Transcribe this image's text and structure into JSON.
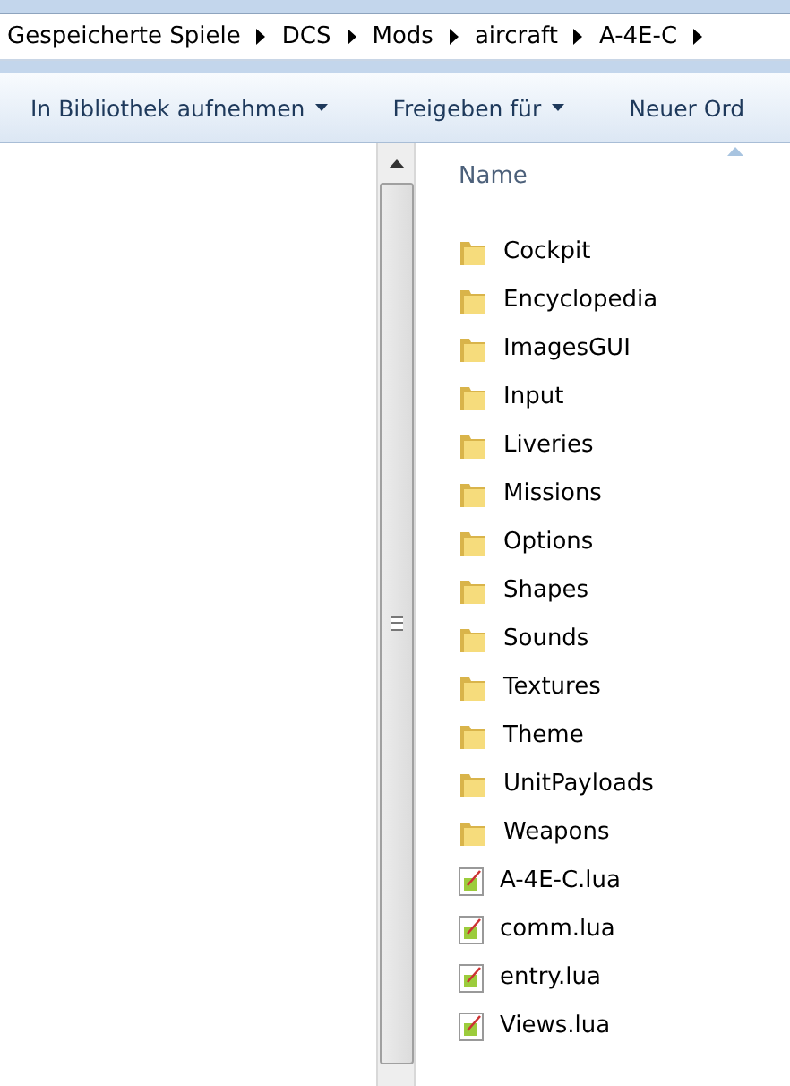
{
  "breadcrumb": [
    "Gespeicherte Spiele",
    "DCS",
    "Mods",
    "aircraft",
    "A-4E-C"
  ],
  "toolbar": [
    {
      "label": "In Bibliothek aufnehmen",
      "dropdown": true
    },
    {
      "label": "Freigeben für",
      "dropdown": true
    },
    {
      "label": "Neuer Ord",
      "dropdown": false
    }
  ],
  "list": {
    "column": "Name",
    "items": [
      {
        "name": "Cockpit",
        "kind": "folder"
      },
      {
        "name": "Encyclopedia",
        "kind": "folder"
      },
      {
        "name": "ImagesGUI",
        "kind": "folder"
      },
      {
        "name": "Input",
        "kind": "folder"
      },
      {
        "name": "Liveries",
        "kind": "folder"
      },
      {
        "name": "Missions",
        "kind": "folder"
      },
      {
        "name": "Options",
        "kind": "folder"
      },
      {
        "name": "Shapes",
        "kind": "folder"
      },
      {
        "name": "Sounds",
        "kind": "folder"
      },
      {
        "name": "Textures",
        "kind": "folder"
      },
      {
        "name": "Theme",
        "kind": "folder"
      },
      {
        "name": "UnitPayloads",
        "kind": "folder"
      },
      {
        "name": "Weapons",
        "kind": "folder"
      },
      {
        "name": "A-4E-C.lua",
        "kind": "file"
      },
      {
        "name": "comm.lua",
        "kind": "file"
      },
      {
        "name": "entry.lua",
        "kind": "file"
      },
      {
        "name": "Views.lua",
        "kind": "file"
      }
    ]
  }
}
